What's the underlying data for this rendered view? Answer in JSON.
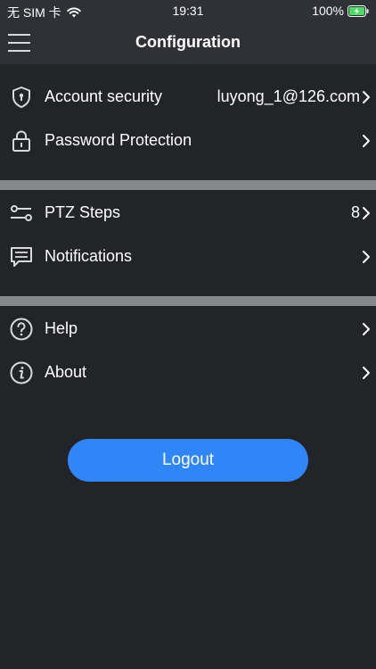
{
  "status_bar": {
    "carrier": "无 SIM 卡",
    "time": "19:31",
    "battery": "100%",
    "icons": [
      "wifi-icon",
      "battery-charging-icon"
    ]
  },
  "nav": {
    "title": "Configuration",
    "menu_icon": "hamburger-menu-icon"
  },
  "sections": [
    {
      "rows": [
        {
          "label": "Account security",
          "value": "luyong_1@126.com",
          "icon": "shield-icon"
        },
        {
          "label": "Password Protection",
          "value": "",
          "icon": "lock-icon"
        }
      ]
    },
    {
      "rows": [
        {
          "label": "PTZ Steps",
          "value": "8",
          "icon": "sliders-icon"
        },
        {
          "label": "Notifications",
          "value": "",
          "icon": "message-icon"
        }
      ]
    },
    {
      "rows": [
        {
          "label": "Help",
          "value": "",
          "icon": "help-icon"
        },
        {
          "label": "About",
          "value": "",
          "icon": "info-icon"
        }
      ]
    }
  ],
  "logout": {
    "label": "Logout"
  },
  "colors": {
    "background": "#222428",
    "bar": "#2f3136",
    "divider": "#87888b",
    "accent": "#3086f6",
    "text": "#ffffff"
  }
}
